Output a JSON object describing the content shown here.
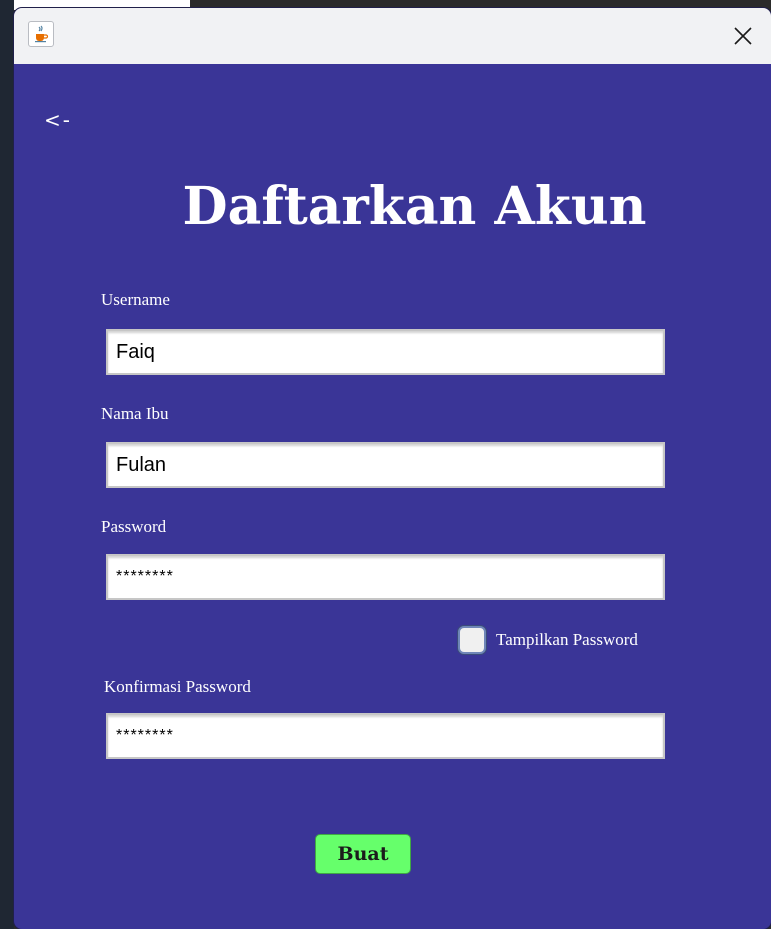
{
  "window": {
    "close_icon": "close-icon",
    "app_icon": "java-cup-icon"
  },
  "form": {
    "back_label": "<-",
    "title": "Daftarkan Akun",
    "username_label": "Username",
    "username_value": "Faiq",
    "mother_name_label": "Nama Ibu",
    "mother_name_value": "Fulan",
    "password_label": "Password",
    "password_value": "********",
    "show_password_label": "Tampilkan Password",
    "show_password_checked": false,
    "confirm_password_label": "Konfirmasi Password",
    "confirm_password_value": "********",
    "submit_label": "Buat"
  },
  "colors": {
    "background": "#3a3597",
    "titlebar": "#f1f2f4",
    "submit_button": "#66ff6b",
    "text": "#ffffff"
  }
}
